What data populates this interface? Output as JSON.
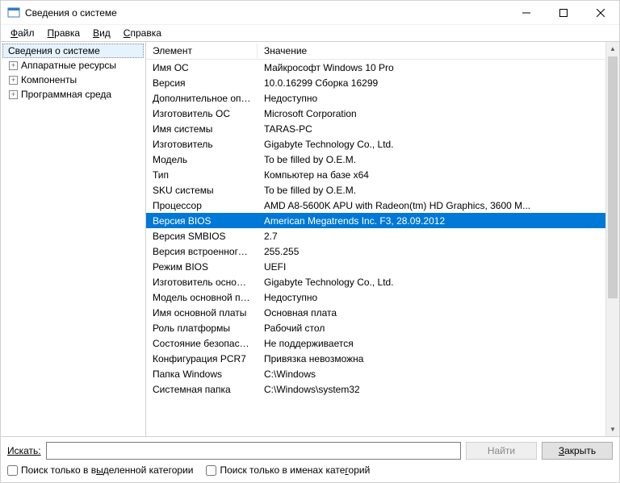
{
  "title": "Сведения о системе",
  "menu": {
    "file": "Файл",
    "edit": "Правка",
    "view": "Вид",
    "help": "Справка"
  },
  "tree": {
    "root": "Сведения о системе",
    "items": [
      "Аппаратные ресурсы",
      "Компоненты",
      "Программная среда"
    ]
  },
  "table": {
    "col1": "Элемент",
    "col2": "Значение",
    "rows": [
      {
        "k": "Имя ОС",
        "v": "Майкрософт Windows 10 Pro"
      },
      {
        "k": "Версия",
        "v": "10.0.16299 Сборка 16299"
      },
      {
        "k": "Дополнительное опис...",
        "v": "Недоступно"
      },
      {
        "k": "Изготовитель ОС",
        "v": "Microsoft Corporation"
      },
      {
        "k": "Имя системы",
        "v": "TARAS-PC"
      },
      {
        "k": "Изготовитель",
        "v": "Gigabyte Technology Co., Ltd."
      },
      {
        "k": "Модель",
        "v": "To be filled by O.E.M."
      },
      {
        "k": "Тип",
        "v": "Компьютер на базе x64"
      },
      {
        "k": "SKU системы",
        "v": "To be filled by O.E.M."
      },
      {
        "k": "Процессор",
        "v": "AMD A8-5600K APU with Radeon(tm) HD Graphics, 3600 М..."
      },
      {
        "k": "Версия BIOS",
        "v": "American Megatrends Inc. F3, 28.09.2012",
        "selected": true
      },
      {
        "k": "Версия SMBIOS",
        "v": "2.7"
      },
      {
        "k": "Версия встроенного к...",
        "v": "255.255"
      },
      {
        "k": "Режим BIOS",
        "v": "UEFI"
      },
      {
        "k": "Изготовитель основно...",
        "v": "Gigabyte Technology Co., Ltd."
      },
      {
        "k": "Модель основной пла...",
        "v": "Недоступно"
      },
      {
        "k": "Имя основной платы",
        "v": "Основная плата"
      },
      {
        "k": "Роль платформы",
        "v": "Рабочий стол"
      },
      {
        "k": "Состояние безопасно...",
        "v": "Не поддерживается"
      },
      {
        "k": "Конфигурация PCR7",
        "v": "Привязка невозможна"
      },
      {
        "k": "Папка Windows",
        "v": "C:\\Windows"
      },
      {
        "k": "Системная папка",
        "v": "C:\\Windows\\system32"
      }
    ]
  },
  "bottom": {
    "search_label_pre": "И",
    "search_label_post": "скать:",
    "find": "Найти",
    "close_pre": "З",
    "close_post": "акрыть",
    "cb1_pre": "Поиск только в в",
    "cb1_post": "ыделенной категории",
    "cb2_pre": "Поиск только в именах кате",
    "cb2_post": "горий"
  }
}
